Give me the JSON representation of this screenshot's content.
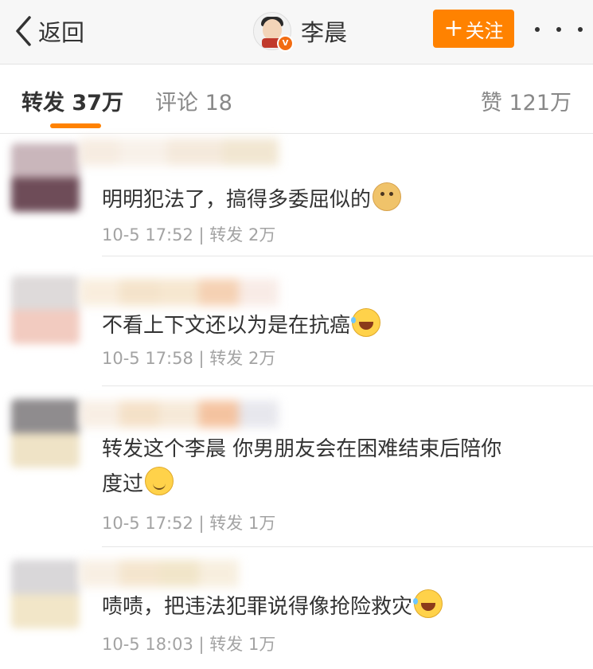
{
  "header": {
    "back_label": "返回",
    "profile_name": "李晨",
    "badge": "V",
    "follow_label": "关注"
  },
  "tabs": {
    "repost": "转发 37万",
    "comment": "评论 18",
    "like": "赞 121万"
  },
  "reposts": [
    {
      "text": "明明犯法了，搞得多委屈似的",
      "emoji": "doge-icon",
      "meta": "10-5 17:52 | 转发 2万"
    },
    {
      "text": "不看上下文还以为是在抗癌",
      "emoji": "laugh-cry-icon",
      "meta": "10-5 17:58 | 转发 2万"
    },
    {
      "text_line1": "转发这个李晨 你男朋友会在困难结束后陪你",
      "text_line2": "度过",
      "emoji": "smile-icon",
      "meta": "10-5 17:52 | 转发 1万"
    },
    {
      "text": "啧啧，把违法犯罪说得像抢险救灾",
      "emoji": "laugh-cry-icon",
      "meta": "10-5 18:03 | 转发 1万"
    }
  ],
  "colors": {
    "accent": "#ff8200",
    "text": "#333333",
    "meta": "#a3a3a3"
  }
}
